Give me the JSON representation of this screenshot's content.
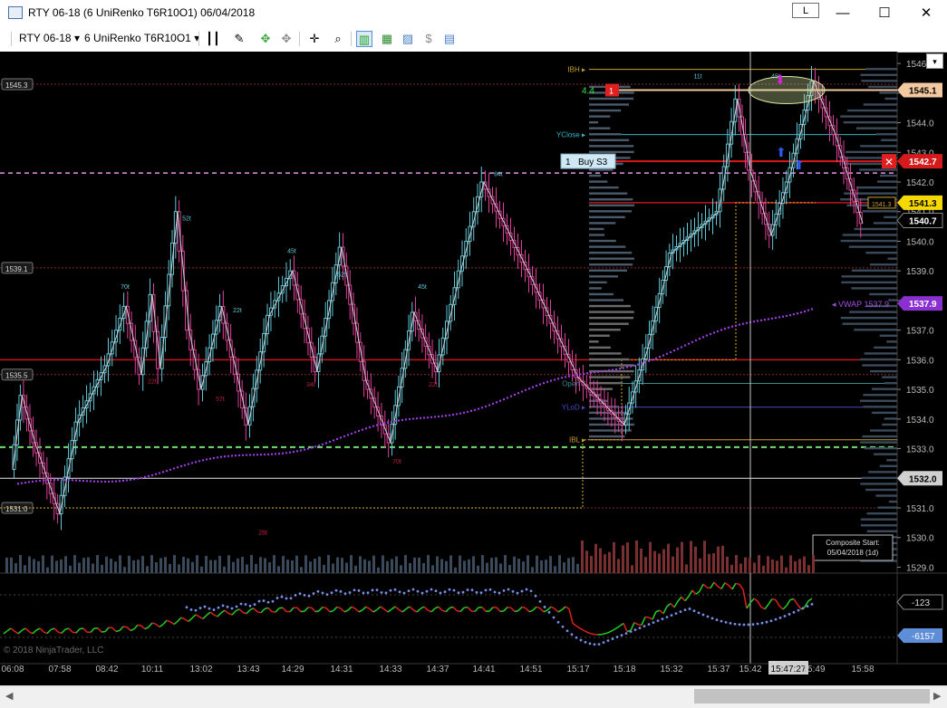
{
  "window": {
    "title": "RTY 06-18 (6 UniRenko T6R10O1)  06/04/2018",
    "link_button": "L",
    "minimize": "—",
    "maximize": "☐",
    "close": "✕"
  },
  "toolbar": {
    "instrument": "RTY 06-18",
    "bar_type": "6 UniRenko T6R10O1",
    "dropdown_arrow": "▾"
  },
  "colors": {
    "background": "#000000",
    "up_bar": "#5fc8d8",
    "down_bar": "#e0409a",
    "vwap": "#9b3fe0",
    "cvd_up": "#22d022",
    "cvd_down": "#e02020",
    "cvd_dots": "#7a8ee8",
    "price_marker": "#4a4a4a"
  },
  "chart_data": {
    "type": "line",
    "title": "",
    "x_ticks": [
      "06:08",
      "07:58",
      "08:42",
      "10:11",
      "13:02",
      "13:43",
      "14:29",
      "14:31",
      "14:33",
      "14:37",
      "14:41",
      "14:51",
      "15:17",
      "15:18",
      "15:32",
      "15:37",
      "15:42",
      "15:47:27",
      "15:49",
      "15:58"
    ],
    "y_ticks": [
      "1546.0",
      "1545.0",
      "1544.0",
      "1543.0",
      "1542.0",
      "1541.0",
      "1540.0",
      "1539.0",
      "1538.0",
      "1537.0",
      "1536.0",
      "1535.0",
      "1534.0",
      "1533.0",
      "1532.0",
      "1531.0",
      "1530.0",
      "1529.0"
    ],
    "ylim": [
      1528.8,
      1546.4
    ],
    "price_path": [
      {
        "x": "06:08",
        "y": 1532.3
      },
      {
        "x": "06:30",
        "y": 1534.8
      },
      {
        "x": "07:00",
        "y": 1533.2
      },
      {
        "x": "07:58",
        "y": 1530.8
      },
      {
        "x": "08:15",
        "y": 1533.9
      },
      {
        "x": "08:42",
        "y": 1535.8
      },
      {
        "x": "09:20",
        "y": 1537.8
      },
      {
        "x": "09:50",
        "y": 1535.5
      },
      {
        "x": "10:11",
        "y": 1538.2
      },
      {
        "x": "10:40",
        "y": 1535.7
      },
      {
        "x": "11:40",
        "y": 1541.0
      },
      {
        "x": "12:20",
        "y": 1537.0
      },
      {
        "x": "13:02",
        "y": 1535.0
      },
      {
        "x": "13:20",
        "y": 1537.8
      },
      {
        "x": "13:43",
        "y": 1533.8
      },
      {
        "x": "14:05",
        "y": 1537.5
      },
      {
        "x": "14:29",
        "y": 1539.0
      },
      {
        "x": "14:30",
        "y": 1535.6
      },
      {
        "x": "14:31",
        "y": 1539.8
      },
      {
        "x": "14:32",
        "y": 1535.3
      },
      {
        "x": "14:33",
        "y": 1533.2
      },
      {
        "x": "14:35",
        "y": 1537.6
      },
      {
        "x": "14:37",
        "y": 1535.6
      },
      {
        "x": "14:39",
        "y": 1539.0
      },
      {
        "x": "14:41",
        "y": 1542.0
      },
      {
        "x": "14:51",
        "y": 1538.8
      },
      {
        "x": "15:17",
        "y": 1535.4
      },
      {
        "x": "15:18",
        "y": 1533.8
      },
      {
        "x": "15:25",
        "y": 1536.4
      },
      {
        "x": "15:32",
        "y": 1539.6
      },
      {
        "x": "15:37",
        "y": 1541.0
      },
      {
        "x": "15:40",
        "y": 1544.8
      },
      {
        "x": "15:42",
        "y": 1542.4
      },
      {
        "x": "15:45",
        "y": 1540.2
      },
      {
        "x": "15:47:27",
        "y": 1542.0
      },
      {
        "x": "15:49",
        "y": 1545.4
      },
      {
        "x": "15:53",
        "y": 1543.6
      },
      {
        "x": "15:58",
        "y": 1540.6
      }
    ],
    "price_line_labels": [
      {
        "label": "1545.3",
        "value": 1545.3
      },
      {
        "label": "1539.1",
        "value": 1539.1
      },
      {
        "label": "1535.5",
        "value": 1535.5
      },
      {
        "label": "1531.0",
        "value": 1531.0
      }
    ],
    "levels": [
      {
        "name": "IBH",
        "value": 1545.8
      },
      {
        "name": "YClose",
        "value": 1543.6
      },
      {
        "name": "Open",
        "value": 1535.2
      },
      {
        "name": "YLoD",
        "value": 1534.4
      },
      {
        "name": "IBL",
        "value": 1533.3
      }
    ],
    "swing_labels": [
      {
        "text": "70t",
        "y": 1538.4
      },
      {
        "text": "52t",
        "y": 1540.7
      },
      {
        "text": "22t",
        "y": 1537.6
      },
      {
        "text": "45t",
        "y": 1539.6
      },
      {
        "text": "52t",
        "y": 1538.8
      },
      {
        "text": "45t",
        "y": 1538.4
      },
      {
        "text": "64t",
        "y": 1542.2
      },
      {
        "text": "11t",
        "y": 1545.5
      },
      {
        "text": "45t",
        "y": 1545.5
      },
      {
        "text": "28t",
        "y": 1530.1
      },
      {
        "text": "22t",
        "y": 1535.2
      },
      {
        "text": "57t",
        "y": 1534.6
      },
      {
        "text": "34t",
        "y": 1535.1
      },
      {
        "text": "70t",
        "y": 1532.5
      },
      {
        "text": "22t",
        "y": 1535.1
      }
    ],
    "right_axis_markers": [
      {
        "label": "1545.1",
        "value": 1545.1,
        "color": "#f2c9a0"
      },
      {
        "label": "1542.7",
        "value": 1542.7,
        "color": "#d41a1a"
      },
      {
        "label": "1541.3",
        "value": 1541.3,
        "color": "#f5d800"
      },
      {
        "label": "1540.7",
        "value": 1540.7,
        "color": "#000000"
      },
      {
        "label": "1537.9",
        "value": 1537.9,
        "color": "#8a2fd0"
      },
      {
        "label": "1532.0",
        "value": 1532.0,
        "color": "#d0d0d0"
      }
    ],
    "order": {
      "qty": "1",
      "label": "Buy S3",
      "value": 1542.7
    },
    "position": {
      "qty": "1",
      "pnl": "4.4",
      "value": 1545.1
    },
    "vwap": {
      "label": "VWAP",
      "value": "1537.9"
    },
    "composite_note": [
      "Composite Start:",
      "05/04/2018 (1d)"
    ],
    "cvd_panel": {
      "labels": [
        {
          "text": "-123",
          "color": "#cfcfcf"
        },
        {
          "text": "-6157",
          "color": "#5f8ed8"
        }
      ]
    },
    "crosshair": {
      "time": "15:47:27"
    },
    "copyright": "© 2018 NinjaTrader, LLC",
    "grid": false,
    "legend": "none"
  }
}
